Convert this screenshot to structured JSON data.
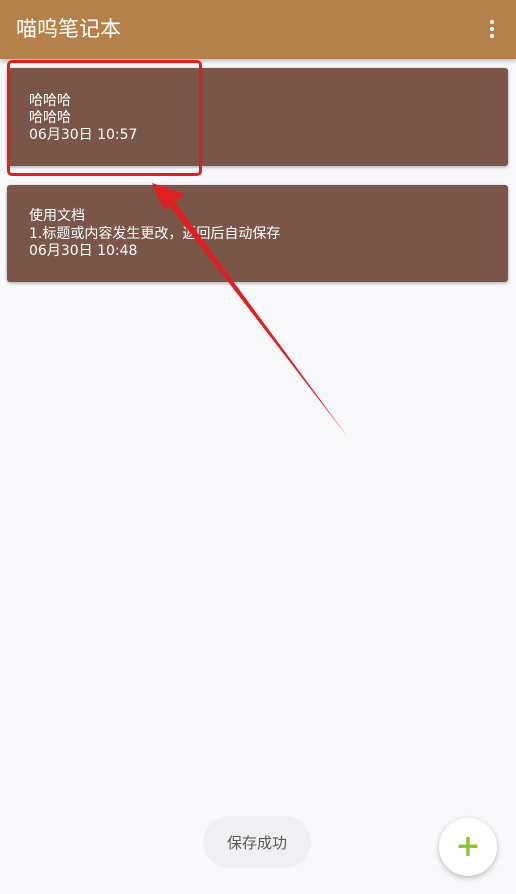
{
  "app_bar": {
    "title": "喵呜笔记本",
    "menu_icon": "more-vert-icon",
    "background_color": "#b5814a"
  },
  "notes": [
    {
      "title": "哈哈哈",
      "content": "哈哈哈",
      "time": "06月30日 10:57"
    },
    {
      "title": "使用文档",
      "content": "1.标题或内容发生更改，返回后自动保存",
      "time": "06月30日 10:48"
    }
  ],
  "card_color": "#7a5649",
  "annotation_color": "#e02020",
  "toast": {
    "text": "保存成功"
  },
  "fab": {
    "icon": "plus-icon",
    "symbol": "+",
    "color": "#8cc43a"
  }
}
